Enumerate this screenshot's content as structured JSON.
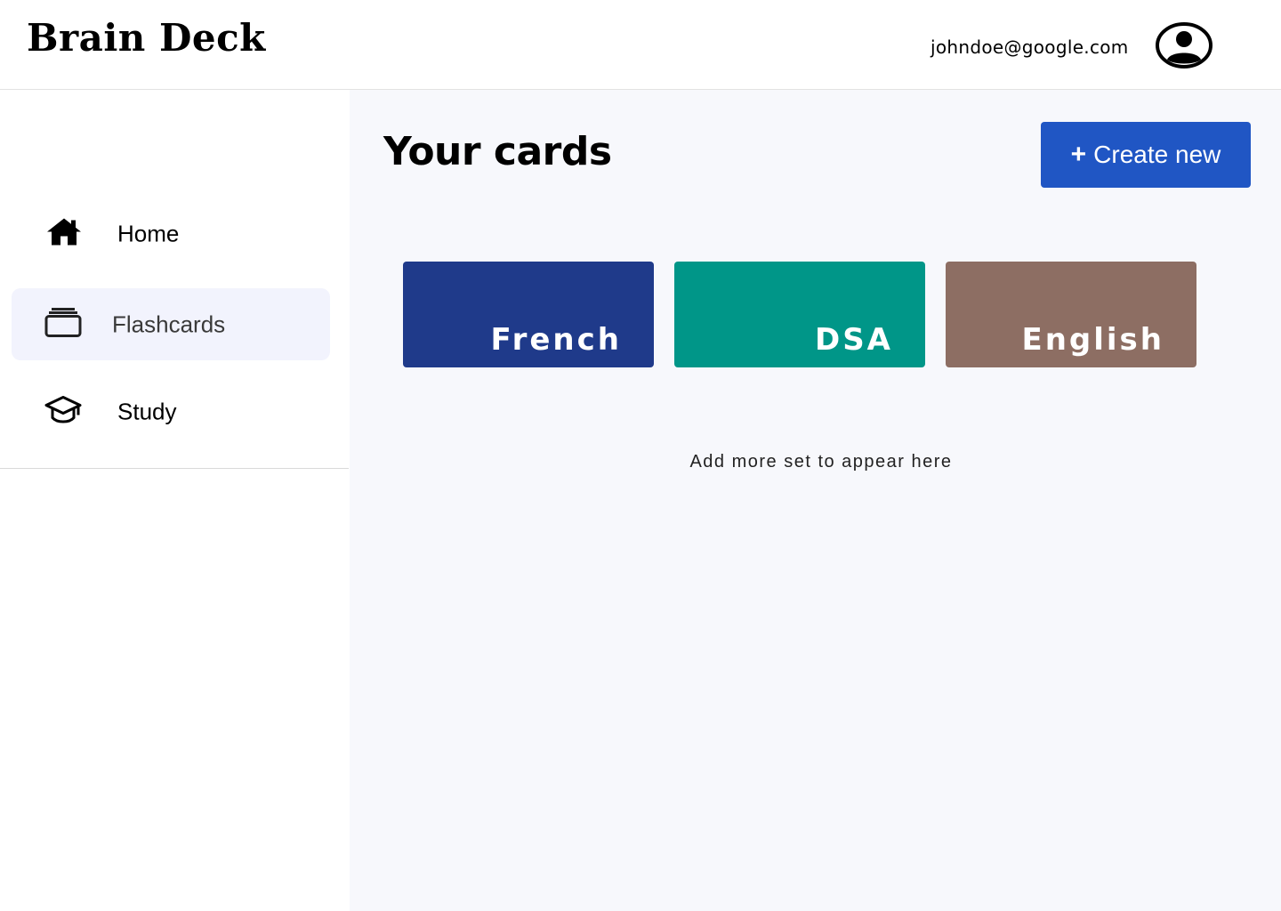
{
  "header": {
    "logo": "Brain Deck",
    "user_email": "johndoe@google.com",
    "avatar_icon": "user-circle-icon"
  },
  "sidebar": {
    "items": [
      {
        "label": "Home",
        "icon": "home-icon",
        "active": false
      },
      {
        "label": "Flashcards",
        "icon": "cards-stack-icon",
        "active": true
      },
      {
        "label": "Study",
        "icon": "graduation-cap-icon",
        "active": false
      }
    ]
  },
  "main": {
    "title": "Your cards",
    "create_button": {
      "icon": "plus-icon",
      "symbol": "+",
      "label": "Create new"
    },
    "cards": [
      {
        "label": "French",
        "color": "#1f3a8a"
      },
      {
        "label": "DSA",
        "color": "#009688"
      },
      {
        "label": "English",
        "color": "#8d6e63"
      }
    ],
    "hint": "Add more set to appear here"
  },
  "colors": {
    "accent": "#2056c4",
    "active_nav_bg": "#f2f3fd",
    "main_bg": "#f7f8fc"
  }
}
